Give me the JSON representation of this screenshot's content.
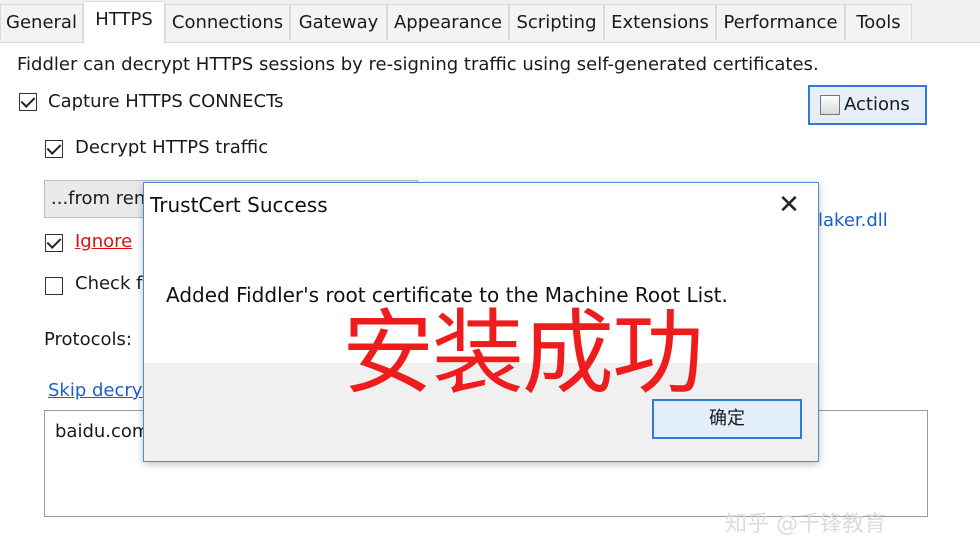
{
  "tabs": [
    {
      "label": "General"
    },
    {
      "label": "HTTPS",
      "active": true
    },
    {
      "label": "Connections"
    },
    {
      "label": "Gateway"
    },
    {
      "label": "Appearance"
    },
    {
      "label": "Scripting"
    },
    {
      "label": "Extensions"
    },
    {
      "label": "Performance"
    },
    {
      "label": "Tools"
    }
  ],
  "https": {
    "intro": "Fiddler can decrypt HTTPS sessions by re-signing traffic using self-generated certificates.",
    "capture_connects": {
      "label": "Capture HTTPS CONNECTs",
      "checked": true
    },
    "decrypt_traffic": {
      "label": "Decrypt HTTPS traffic",
      "checked": true
    },
    "source_dropdown": "...from ren",
    "ignore_errors": {
      "label": "Ignore",
      "checked": true
    },
    "check_revocation": {
      "label": "Check f",
      "checked": false
    },
    "protocols_label": "Protocols:",
    "skip_decryption_link": "Skip decry",
    "skip_hosts_value": "baidu.com",
    "cert_maker_text": "laker.dll",
    "actions_label": "Actions"
  },
  "dialog": {
    "title": "TrustCert Success",
    "message": "Added Fiddler's root certificate to the Machine Root List.",
    "ok_label": "确定",
    "close_glyph": "✕"
  },
  "overlay_text": "安装成功",
  "watermark": "知乎 @千锋教育",
  "colors": {
    "accent": "#2f7ad8",
    "overlay": "#ee1c1c",
    "link": "#1a5fd0"
  }
}
